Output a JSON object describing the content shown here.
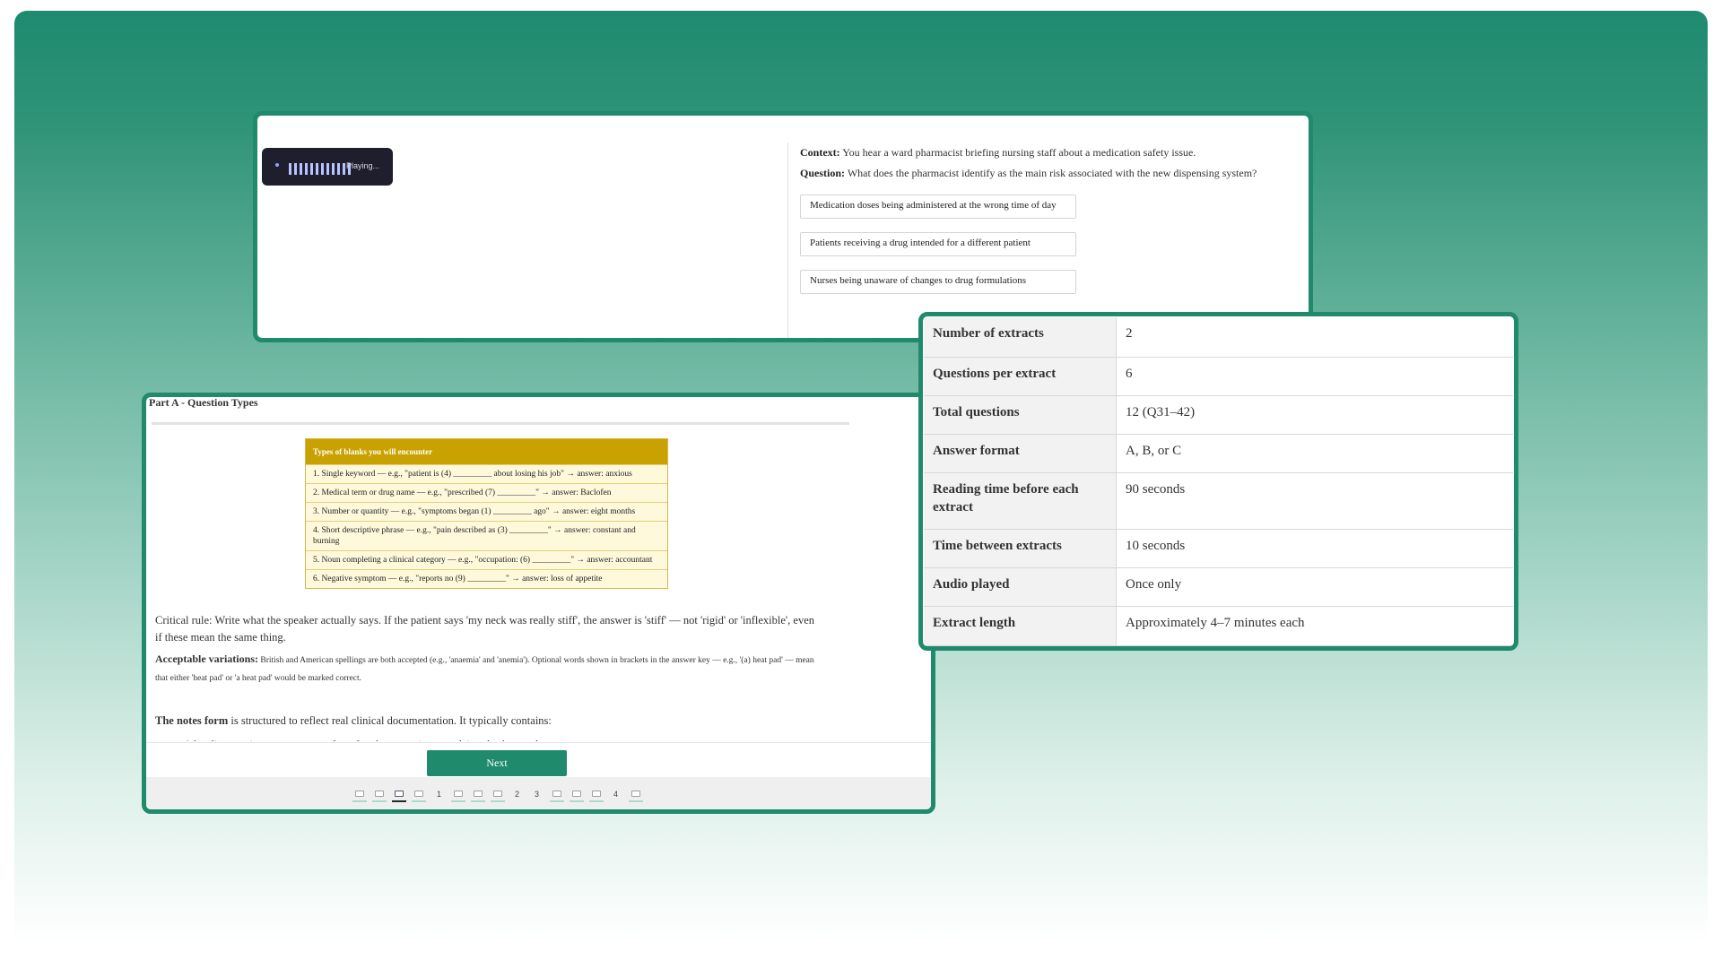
{
  "top_panel": {
    "player_status": "Playing...",
    "context_label": "Context:",
    "context_text": "You hear a ward pharmacist briefing nursing staff about a medication safety issue.",
    "question_label": "Question:",
    "question_text": "What does the pharmacist identify as the main risk associated with the new dispensing system?",
    "options": [
      "Medication doses being administered at the wrong time of day",
      "Patients receiving a drug intended for a different patient",
      "Nurses being unaware of changes to drug formulations"
    ]
  },
  "info_table": {
    "rows": [
      {
        "label": "Number of extracts",
        "value": "2"
      },
      {
        "label": "Questions per extract",
        "value": "6"
      },
      {
        "label": "Total questions",
        "value": "12 (Q31–42)"
      },
      {
        "label": "Answer format",
        "value": "A, B, or C"
      },
      {
        "label": "Reading time before each extract",
        "value": "90 seconds"
      },
      {
        "label": "Time between extracts",
        "value": "10 seconds"
      },
      {
        "label": "Audio played",
        "value": "Once only"
      },
      {
        "label": "Extract length",
        "value": "Approximately 4–7 minutes each"
      }
    ]
  },
  "lesson": {
    "part_title": "Part A - Question Types",
    "blanks_heading": "Types of blanks you will encounter",
    "blanks": [
      "1. Single keyword — e.g., \"patient is (4) _________ about losing his job\" → answer: anxious",
      "2. Medical term or drug name — e.g., \"prescribed (7) _________\" → answer: Baclofen",
      "3. Number or quantity — e.g., \"symptoms began (1) _________ ago\" → answer: eight months",
      "4. Short descriptive phrase — e.g., \"pain described as (3) _________\" → answer: constant and burning",
      "5. Noun completing a clinical category — e.g., \"occupation: (6) _________\" → answer: accountant",
      "6. Negative symptom — e.g., \"reports no (9) _________\" → answer: loss of appetite"
    ],
    "critical_rule": "Critical rule: Write what the speaker actually says. If the patient says 'my neck was really stiff', the answer is 'stiff' — not 'rigid' or 'inflexible', even if these mean the same thing.",
    "acceptable_label": "Acceptable variations:",
    "acceptable_text": "British and American spellings are both accepted (e.g., 'anaemia' and 'anemia'). Optional words shown in brackets in the answer key — e.g., '(a) heat pad' — mean that either 'heat pad' or 'a heat pad' would be marked correct.",
    "notes_label": "The notes form",
    "notes_text": "is structured to reflect real clinical documentation. It typically contains:",
    "cut_text": "A heading · patient name · reason for referral · presenting complaint · background",
    "next_label": "Next",
    "pager_numbers": [
      "1",
      "2",
      "3",
      "4"
    ]
  }
}
